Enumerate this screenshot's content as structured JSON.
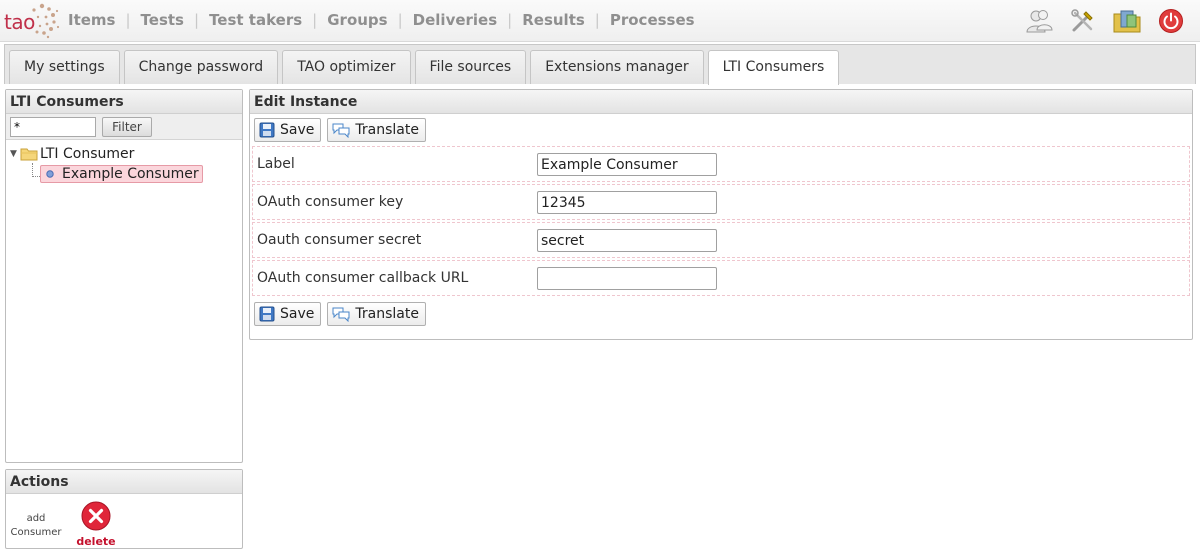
{
  "app": {
    "logo_text": "tao",
    "main_nav": [
      "Items",
      "Tests",
      "Test takers",
      "Groups",
      "Deliveries",
      "Results",
      "Processes"
    ],
    "top_icons": [
      "users-icon",
      "tools-icon",
      "media-folder-icon",
      "power-icon"
    ]
  },
  "settings_tabs": {
    "items": [
      "My settings",
      "Change password",
      "TAO optimizer",
      "File sources",
      "Extensions manager",
      "LTI Consumers"
    ],
    "active": "LTI Consumers"
  },
  "tree_panel": {
    "title": "LTI Consumers",
    "filter_value": "*",
    "filter_button": "Filter",
    "root_label": "LTI Consumer",
    "child_label": "Example Consumer"
  },
  "actions_panel": {
    "title": "Actions",
    "add_label": "add Consumer",
    "delete_label": "delete"
  },
  "edit_panel": {
    "title": "Edit Instance",
    "save_label": "Save",
    "translate_label": "Translate",
    "fields": [
      {
        "label": "Label",
        "value": "Example Consumer"
      },
      {
        "label": "OAuth consumer key",
        "value": "12345"
      },
      {
        "label": "Oauth consumer secret",
        "value": "secret"
      },
      {
        "label": "OAuth consumer callback URL",
        "value": ""
      }
    ]
  },
  "colors": {
    "brand": "#c0304a",
    "nav_text": "#8f8f8f",
    "selected_bg": "#fbd6dc",
    "delete_red": "#c4102c"
  }
}
